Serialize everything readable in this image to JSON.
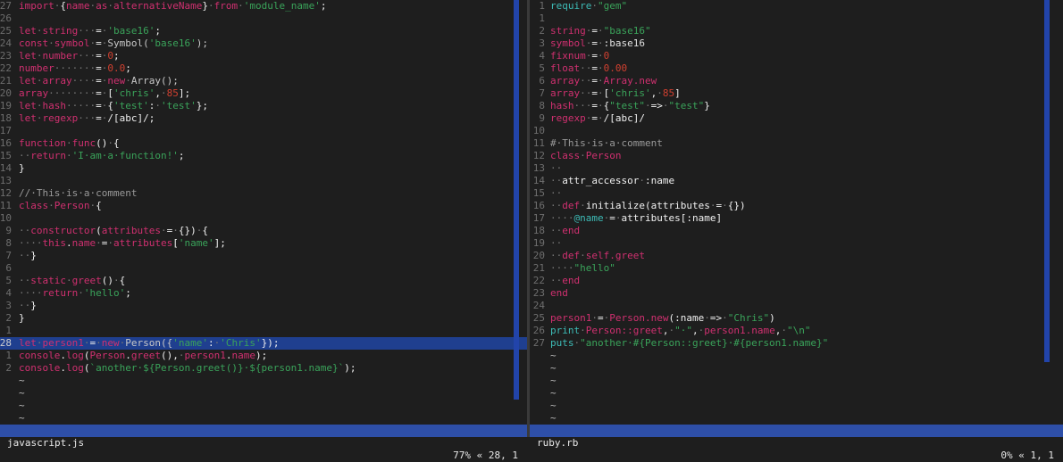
{
  "editor": {
    "left_file": "javascript.js",
    "left_position": "77% « 28, 1",
    "right_file": "ruby.rb",
    "right_position": "0% « 1, 1"
  },
  "colors": {
    "background": "#1e1e1e",
    "status_bar": "#2e4fa8",
    "highlight_line": "#1f3f8f",
    "keyword": "#d03070",
    "string": "#3aa35a",
    "comment": "#999999",
    "line_number": "#6e6e6e"
  },
  "left_lines": [
    {
      "n": "27",
      "segs": [
        [
          "k",
          "import"
        ],
        [
          "d",
          "·"
        ],
        [
          "v",
          "{"
        ],
        [
          "k",
          "name"
        ],
        [
          "d",
          "·"
        ],
        [
          "k",
          "as"
        ],
        [
          "d",
          "·"
        ],
        [
          "k",
          "alternativeName"
        ],
        [
          "v",
          "}"
        ],
        [
          "d",
          "·"
        ],
        [
          "k",
          "from"
        ],
        [
          "d",
          "·"
        ],
        [
          "s",
          "'module_name'"
        ],
        [
          "v",
          ";"
        ]
      ]
    },
    {
      "n": "26",
      "segs": []
    },
    {
      "n": "25",
      "segs": [
        [
          "k",
          "let"
        ],
        [
          "d",
          "·"
        ],
        [
          "k",
          "string"
        ],
        [
          "d",
          "···"
        ],
        [
          "v",
          "="
        ],
        [
          "d",
          "·"
        ],
        [
          "s",
          "'base16'"
        ],
        [
          "v",
          ";"
        ]
      ]
    },
    {
      "n": "24",
      "segs": [
        [
          "k",
          "const"
        ],
        [
          "d",
          "·"
        ],
        [
          "k",
          "symbol"
        ],
        [
          "d",
          "·"
        ],
        [
          "v",
          "="
        ],
        [
          "d",
          "·"
        ],
        [
          "f",
          "Symbol("
        ],
        [
          "s",
          "'base16'"
        ],
        [
          "f",
          ");"
        ]
      ]
    },
    {
      "n": "23",
      "segs": [
        [
          "k",
          "let"
        ],
        [
          "d",
          "·"
        ],
        [
          "k",
          "number"
        ],
        [
          "d",
          "···"
        ],
        [
          "v",
          "="
        ],
        [
          "d",
          "·"
        ],
        [
          "n",
          "0"
        ],
        [
          "v",
          ";"
        ]
      ]
    },
    {
      "n": "22",
      "segs": [
        [
          "k",
          "number"
        ],
        [
          "d",
          "·······"
        ],
        [
          "v",
          "="
        ],
        [
          "d",
          "·"
        ],
        [
          "n",
          "0.0"
        ],
        [
          "v",
          ";"
        ]
      ]
    },
    {
      "n": "21",
      "segs": [
        [
          "k",
          "let"
        ],
        [
          "d",
          "·"
        ],
        [
          "k",
          "array"
        ],
        [
          "d",
          "····"
        ],
        [
          "v",
          "="
        ],
        [
          "d",
          "·"
        ],
        [
          "k",
          "new"
        ],
        [
          "d",
          "·"
        ],
        [
          "f",
          "Array();"
        ]
      ]
    },
    {
      "n": "20",
      "segs": [
        [
          "k",
          "array"
        ],
        [
          "d",
          "········"
        ],
        [
          "v",
          "="
        ],
        [
          "d",
          "·"
        ],
        [
          "v",
          "["
        ],
        [
          "s",
          "'chris'"
        ],
        [
          "v",
          ","
        ],
        [
          "d",
          "·"
        ],
        [
          "n",
          "85"
        ],
        [
          "v",
          "];"
        ]
      ]
    },
    {
      "n": "19",
      "segs": [
        [
          "k",
          "let"
        ],
        [
          "d",
          "·"
        ],
        [
          "k",
          "hash"
        ],
        [
          "d",
          "·····"
        ],
        [
          "v",
          "="
        ],
        [
          "d",
          "·"
        ],
        [
          "v",
          "{"
        ],
        [
          "s",
          "'test'"
        ],
        [
          "v",
          ":"
        ],
        [
          "d",
          "·"
        ],
        [
          "s",
          "'test'"
        ],
        [
          "v",
          "};"
        ]
      ]
    },
    {
      "n": "18",
      "segs": [
        [
          "k",
          "let"
        ],
        [
          "d",
          "·"
        ],
        [
          "k",
          "regexp"
        ],
        [
          "d",
          "···"
        ],
        [
          "v",
          "="
        ],
        [
          "d",
          "·"
        ],
        [
          "v",
          "/[abc]/;"
        ]
      ]
    },
    {
      "n": "17",
      "segs": []
    },
    {
      "n": "16",
      "segs": [
        [
          "k",
          "function"
        ],
        [
          "d",
          "·"
        ],
        [
          "k",
          "func"
        ],
        [
          "v",
          "()"
        ],
        [
          "d",
          "·"
        ],
        [
          "v",
          "{"
        ]
      ]
    },
    {
      "n": "15",
      "segs": [
        [
          "d",
          "··"
        ],
        [
          "k",
          "return"
        ],
        [
          "d",
          "·"
        ],
        [
          "s",
          "'I·am·a·function!'"
        ],
        [
          "v",
          ";"
        ]
      ]
    },
    {
      "n": "14",
      "segs": [
        [
          "v",
          "}"
        ]
      ]
    },
    {
      "n": "13",
      "segs": []
    },
    {
      "n": "12",
      "segs": [
        [
          "c",
          "//·This·is·a·comment"
        ]
      ]
    },
    {
      "n": "11",
      "segs": [
        [
          "k",
          "class"
        ],
        [
          "d",
          "·"
        ],
        [
          "k",
          "Person"
        ],
        [
          "d",
          "·"
        ],
        [
          "v",
          "{"
        ]
      ]
    },
    {
      "n": "10",
      "segs": []
    },
    {
      "n": "9",
      "segs": [
        [
          "d",
          "··"
        ],
        [
          "k",
          "constructor"
        ],
        [
          "v",
          "("
        ],
        [
          "k",
          "attributes"
        ],
        [
          "d",
          "·"
        ],
        [
          "v",
          "="
        ],
        [
          "d",
          "·"
        ],
        [
          "v",
          "{})"
        ],
        [
          "d",
          "·"
        ],
        [
          "v",
          "{"
        ]
      ]
    },
    {
      "n": "8",
      "segs": [
        [
          "d",
          "····"
        ],
        [
          "k",
          "this"
        ],
        [
          "v",
          "."
        ],
        [
          "k",
          "name"
        ],
        [
          "d",
          "·"
        ],
        [
          "v",
          "="
        ],
        [
          "d",
          "·"
        ],
        [
          "k",
          "attributes"
        ],
        [
          "v",
          "["
        ],
        [
          "s",
          "'name'"
        ],
        [
          "v",
          "];"
        ]
      ]
    },
    {
      "n": "7",
      "segs": [
        [
          "d",
          "··"
        ],
        [
          "v",
          "}"
        ]
      ]
    },
    {
      "n": "6",
      "segs": []
    },
    {
      "n": "5",
      "segs": [
        [
          "d",
          "··"
        ],
        [
          "k",
          "static"
        ],
        [
          "d",
          "·"
        ],
        [
          "k",
          "greet"
        ],
        [
          "v",
          "()"
        ],
        [
          "d",
          "·"
        ],
        [
          "v",
          "{"
        ]
      ]
    },
    {
      "n": "4",
      "segs": [
        [
          "d",
          "····"
        ],
        [
          "k",
          "return"
        ],
        [
          "d",
          "·"
        ],
        [
          "s",
          "'hello'"
        ],
        [
          "v",
          ";"
        ]
      ]
    },
    {
      "n": "3",
      "segs": [
        [
          "d",
          "··"
        ],
        [
          "v",
          "}"
        ]
      ]
    },
    {
      "n": "2",
      "segs": [
        [
          "v",
          "}"
        ]
      ]
    },
    {
      "n": "1",
      "segs": []
    },
    {
      "n": "28",
      "hl": true,
      "segs": [
        [
          "k",
          "let"
        ],
        [
          "d",
          "·"
        ],
        [
          "k",
          "person1"
        ],
        [
          "d",
          "·"
        ],
        [
          "v",
          "="
        ],
        [
          "d",
          "·"
        ],
        [
          "k",
          "new"
        ],
        [
          "d",
          "·"
        ],
        [
          "f",
          "Person({"
        ],
        [
          "s",
          "'name'"
        ],
        [
          "v",
          ":"
        ],
        [
          "d",
          "·"
        ],
        [
          "s",
          "'Chris'"
        ],
        [
          "v",
          "});"
        ]
      ]
    },
    {
      "n": "1",
      "segs": [
        [
          "k",
          "console"
        ],
        [
          "v",
          "."
        ],
        [
          "k",
          "log"
        ],
        [
          "v",
          "("
        ],
        [
          "k",
          "Person"
        ],
        [
          "v",
          "."
        ],
        [
          "k",
          "greet"
        ],
        [
          "v",
          "(),"
        ],
        [
          "d",
          "·"
        ],
        [
          "k",
          "person1"
        ],
        [
          "v",
          "."
        ],
        [
          "k",
          "name"
        ],
        [
          "v",
          ");"
        ]
      ]
    },
    {
      "n": "2",
      "segs": [
        [
          "k",
          "console"
        ],
        [
          "v",
          "."
        ],
        [
          "k",
          "log"
        ],
        [
          "v",
          "("
        ],
        [
          "s",
          "`another·${Person.greet()}·${person1.name}`"
        ],
        [
          "v",
          ");"
        ]
      ]
    }
  ],
  "left_tildes": [
    "~",
    "~",
    "~",
    "~"
  ],
  "right_lines": [
    {
      "n": "1",
      "segs": [
        [
          "cy",
          "require"
        ],
        [
          "d",
          "·"
        ],
        [
          "s",
          "\"gem\""
        ]
      ]
    },
    {
      "n": "1",
      "segs": []
    },
    {
      "n": "2",
      "segs": [
        [
          "k",
          "string"
        ],
        [
          "d",
          "·"
        ],
        [
          "v",
          "="
        ],
        [
          "d",
          "·"
        ],
        [
          "s",
          "\"base16\""
        ]
      ]
    },
    {
      "n": "3",
      "segs": [
        [
          "k",
          "symbol"
        ],
        [
          "d",
          "·"
        ],
        [
          "v",
          "="
        ],
        [
          "d",
          "·"
        ],
        [
          "sym",
          ":base16"
        ]
      ]
    },
    {
      "n": "4",
      "segs": [
        [
          "k",
          "fixnum"
        ],
        [
          "d",
          "·"
        ],
        [
          "v",
          "="
        ],
        [
          "d",
          "·"
        ],
        [
          "n",
          "0"
        ]
      ]
    },
    {
      "n": "5",
      "segs": [
        [
          "k",
          "float"
        ],
        [
          "d",
          "··"
        ],
        [
          "v",
          "="
        ],
        [
          "d",
          "·"
        ],
        [
          "n",
          "0.00"
        ]
      ]
    },
    {
      "n": "6",
      "segs": [
        [
          "k",
          "array"
        ],
        [
          "d",
          "··"
        ],
        [
          "v",
          "="
        ],
        [
          "d",
          "·"
        ],
        [
          "k",
          "Array.new"
        ]
      ]
    },
    {
      "n": "7",
      "segs": [
        [
          "k",
          "array"
        ],
        [
          "d",
          "··"
        ],
        [
          "v",
          "="
        ],
        [
          "d",
          "·"
        ],
        [
          "v",
          "["
        ],
        [
          "s",
          "'chris'"
        ],
        [
          "v",
          ","
        ],
        [
          "d",
          "·"
        ],
        [
          "n",
          "85"
        ],
        [
          "v",
          "]"
        ]
      ]
    },
    {
      "n": "8",
      "segs": [
        [
          "k",
          "hash"
        ],
        [
          "d",
          "···"
        ],
        [
          "v",
          "="
        ],
        [
          "d",
          "·"
        ],
        [
          "v",
          "{"
        ],
        [
          "s",
          "\"test\""
        ],
        [
          "d",
          "·"
        ],
        [
          "v",
          "=>"
        ],
        [
          "d",
          "·"
        ],
        [
          "s",
          "\"test\""
        ],
        [
          "v",
          "}"
        ]
      ]
    },
    {
      "n": "9",
      "segs": [
        [
          "k",
          "regexp"
        ],
        [
          "d",
          "·"
        ],
        [
          "v",
          "="
        ],
        [
          "d",
          "·"
        ],
        [
          "v",
          "/[abc]/"
        ]
      ]
    },
    {
      "n": "10",
      "segs": []
    },
    {
      "n": "11",
      "segs": [
        [
          "c",
          "#·This·is·a·comment"
        ]
      ]
    },
    {
      "n": "12",
      "segs": [
        [
          "k",
          "class"
        ],
        [
          "d",
          "·"
        ],
        [
          "k",
          "Person"
        ]
      ]
    },
    {
      "n": "13",
      "segs": [
        [
          "d",
          "··"
        ]
      ]
    },
    {
      "n": "14",
      "segs": [
        [
          "d",
          "··"
        ],
        [
          "v",
          "attr_accessor"
        ],
        [
          "d",
          "·"
        ],
        [
          "v",
          ":name"
        ]
      ]
    },
    {
      "n": "15",
      "segs": [
        [
          "d",
          "··"
        ]
      ]
    },
    {
      "n": "16",
      "segs": [
        [
          "d",
          "··"
        ],
        [
          "k",
          "def"
        ],
        [
          "d",
          "·"
        ],
        [
          "v",
          "initialize(attributes"
        ],
        [
          "d",
          "·"
        ],
        [
          "v",
          "="
        ],
        [
          "d",
          "·"
        ],
        [
          "v",
          "{})"
        ]
      ]
    },
    {
      "n": "17",
      "segs": [
        [
          "d",
          "····"
        ],
        [
          "cy",
          "@name"
        ],
        [
          "d",
          "·"
        ],
        [
          "v",
          "="
        ],
        [
          "d",
          "·"
        ],
        [
          "v",
          "attributes[:name]"
        ]
      ]
    },
    {
      "n": "18",
      "segs": [
        [
          "d",
          "··"
        ],
        [
          "k",
          "end"
        ]
      ]
    },
    {
      "n": "19",
      "segs": [
        [
          "d",
          "··"
        ]
      ]
    },
    {
      "n": "20",
      "segs": [
        [
          "d",
          "··"
        ],
        [
          "k",
          "def"
        ],
        [
          "d",
          "·"
        ],
        [
          "k",
          "self.greet"
        ]
      ]
    },
    {
      "n": "21",
      "segs": [
        [
          "d",
          "····"
        ],
        [
          "s",
          "\"hello\""
        ]
      ]
    },
    {
      "n": "22",
      "segs": [
        [
          "d",
          "··"
        ],
        [
          "k",
          "end"
        ]
      ]
    },
    {
      "n": "23",
      "segs": [
        [
          "k",
          "end"
        ]
      ]
    },
    {
      "n": "24",
      "segs": []
    },
    {
      "n": "25",
      "segs": [
        [
          "k",
          "person1"
        ],
        [
          "d",
          "·"
        ],
        [
          "v",
          "="
        ],
        [
          "d",
          "·"
        ],
        [
          "k",
          "Person.new"
        ],
        [
          "v",
          "(:name"
        ],
        [
          "d",
          "·"
        ],
        [
          "v",
          "=>"
        ],
        [
          "d",
          "·"
        ],
        [
          "s",
          "\"Chris\""
        ],
        [
          "v",
          ")"
        ]
      ]
    },
    {
      "n": "26",
      "segs": [
        [
          "cy",
          "print"
        ],
        [
          "d",
          "·"
        ],
        [
          "k",
          "Person::greet"
        ],
        [
          "v",
          ","
        ],
        [
          "d",
          "·"
        ],
        [
          "s",
          "\"·\""
        ],
        [
          "v",
          ","
        ],
        [
          "d",
          "·"
        ],
        [
          "k",
          "person1.name"
        ],
        [
          "v",
          ","
        ],
        [
          "d",
          "·"
        ],
        [
          "s",
          "\"\\n\""
        ]
      ]
    },
    {
      "n": "27",
      "segs": [
        [
          "cy",
          "puts"
        ],
        [
          "d",
          "·"
        ],
        [
          "s",
          "\"another·#{Person::greet}·#{person1.name}\""
        ]
      ]
    }
  ],
  "right_tildes": [
    "~",
    "~",
    "~",
    "~",
    "~",
    "~"
  ]
}
